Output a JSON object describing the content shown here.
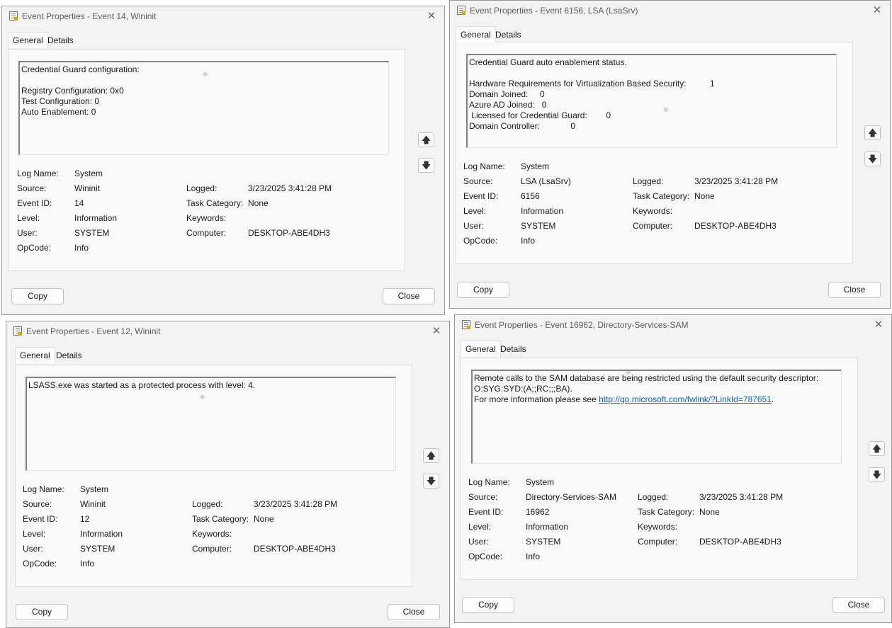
{
  "labels": {
    "log_name": "Log Name:",
    "source": "Source:",
    "event_id": "Event ID:",
    "level": "Level:",
    "user": "User:",
    "opcode": "OpCode:",
    "logged": "Logged:",
    "task_category": "Task Category:",
    "keywords": "Keywords:",
    "computer": "Computer:"
  },
  "tabs": {
    "general": "General",
    "details": "Details"
  },
  "buttons": {
    "copy": "Copy",
    "close": "Close"
  },
  "windows": [
    {
      "title": "Event Properties - Event 14, Wininit",
      "message": [
        "Credential Guard configuration:",
        "",
        "Registry Configuration: 0x0",
        "Test Configuration: 0",
        "Auto Enablement: 0"
      ],
      "log_name": "System",
      "source": "Wininit",
      "event_id": "14",
      "level": "Information",
      "user": "SYSTEM",
      "opcode": "Info",
      "logged": "3/23/2025 3:41:28 PM",
      "task_category": "None",
      "keywords": "",
      "computer": "DESKTOP-ABE4DH3"
    },
    {
      "title": "Event Properties - Event 6156, LSA (LsaSrv)",
      "message": [
        "Credential Guard auto enablement status.",
        "",
        "Hardware Requirements for Virtualization Based Security:          1",
        "Domain Joined:     0",
        "Azure AD Joined:   0",
        " Licensed for Credential Guard:        0",
        "Domain Controller:             0"
      ],
      "log_name": "System",
      "source": "LSA (LsaSrv)",
      "event_id": "6156",
      "level": "Information",
      "user": "SYSTEM",
      "opcode": "Info",
      "logged": "3/23/2025 3:41:28 PM",
      "task_category": "None",
      "keywords": "",
      "computer": "DESKTOP-ABE4DH3"
    },
    {
      "title": "Event Properties - Event 12, Wininit",
      "message": [
        "LSASS.exe was started as a protected process with level: 4."
      ],
      "log_name": "System",
      "source": "Wininit",
      "event_id": "12",
      "level": "Information",
      "user": "SYSTEM",
      "opcode": "Info",
      "logged": "3/23/2025 3:41:28 PM",
      "task_category": "None",
      "keywords": "",
      "computer": "DESKTOP-ABE4DH3"
    },
    {
      "title": "Event Properties - Event 16962, Directory-Services-SAM",
      "message": [
        "Remote calls to the SAM database are being restricted using the default security descriptor:",
        "O:SYG:SYD:(A;;RC;;;BA)."
      ],
      "message_link_prefix": "For more information please see ",
      "message_link": "http://go.microsoft.com/fwlink/?LinkId=787651",
      "message_link_suffix": ".",
      "log_name": "System",
      "source": "Directory-Services-SAM",
      "event_id": "16962",
      "level": "Information",
      "user": "SYSTEM",
      "opcode": "Info",
      "logged": "3/23/2025 3:41:28 PM",
      "task_category": "None",
      "keywords": "",
      "computer": "DESKTOP-ABE4DH3"
    }
  ],
  "icons": {
    "app": "event-properties-icon",
    "close": "close-icon",
    "up": "arrow-up-icon",
    "down": "arrow-down-icon"
  }
}
